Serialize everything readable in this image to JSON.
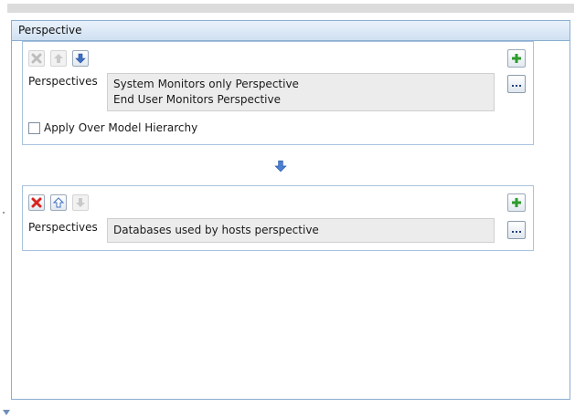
{
  "panel": {
    "title": "Perspective"
  },
  "group1": {
    "label": "Perspectives",
    "items": [
      "System Monitors only Perspective",
      "End User Monitors Perspective"
    ],
    "checkbox_label": "Apply Over Model Hierarchy",
    "checkbox_checked": false,
    "toolbar": {
      "remove": "disabled",
      "move_up": "disabled",
      "move_down": "enabled"
    }
  },
  "group2": {
    "label": "Perspectives",
    "items": [
      "Databases used by hosts perspective"
    ],
    "toolbar": {
      "remove": "enabled",
      "move_up": "enabled",
      "move_down": "disabled"
    }
  },
  "colors": {
    "header": "#cfe0f2",
    "border": "#8aaed1",
    "arrow": "#3e70c2",
    "remove": "#d8241f",
    "add": "#2e9b2e"
  }
}
